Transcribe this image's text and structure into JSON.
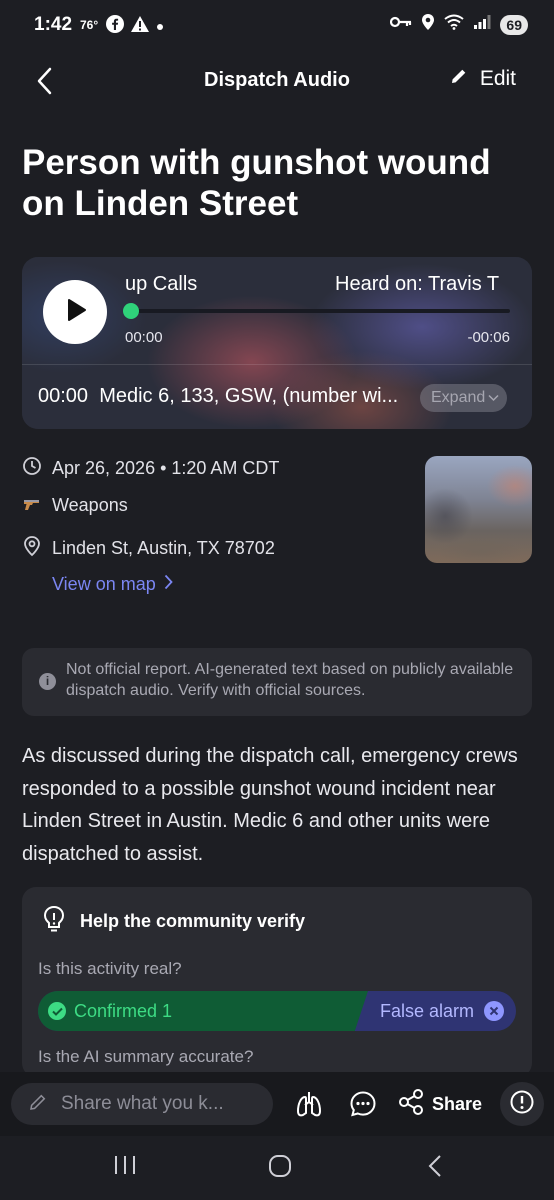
{
  "status_bar": {
    "time": "1:42",
    "temperature": "76°",
    "battery": "69",
    "icons": [
      "facebook-icon",
      "warning-icon",
      "dot-icon",
      "key-icon",
      "location-icon",
      "wifi-icon",
      "signal-icon",
      "battery-icon"
    ]
  },
  "header": {
    "title": "Dispatch Audio",
    "edit_label": "Edit"
  },
  "incident": {
    "title": "Person with gunshot wound on Linden Street"
  },
  "player": {
    "stream_name": "up Calls",
    "heard_on": "Heard on: Travis T",
    "elapsed": "00:00",
    "remaining": "-00:06",
    "progress": 0,
    "transcript_time": "00:00",
    "transcript_text": "Medic 6, 133, GSW, (number wi...",
    "expand_label": "Expand",
    "accent_color": "#2fd27a"
  },
  "details": {
    "datetime": "Apr 26, 2026 • 1:20 AM CDT",
    "category": "Weapons",
    "location": "Linden St, Austin, TX 78702",
    "view_map_label": "View on map",
    "link_color": "#7b86f2"
  },
  "disclaimer": {
    "text": "Not official report. AI-generated text based on publicly available dispatch audio. Verify with official sources."
  },
  "summary": {
    "text": "As discussed during the dispatch call, emergency crews responded to a possible gunshot wound incident near Linden Street in Austin. Medic 6 and other units were dispatched to assist."
  },
  "verify": {
    "title": "Help the community verify",
    "question_real": "Is this activity real?",
    "confirmed_label": "Confirmed 1",
    "false_alarm_label": "False alarm",
    "question_accurate": "Is the AI summary accurate?",
    "confirmed_color": "#0f5c35",
    "false_alarm_color": "#2f3473"
  },
  "bottom_bar": {
    "comment_placeholder": "Share what you k...",
    "share_label": "Share"
  },
  "nav": {
    "items": [
      "recents-icon",
      "home-icon",
      "back-icon"
    ]
  }
}
